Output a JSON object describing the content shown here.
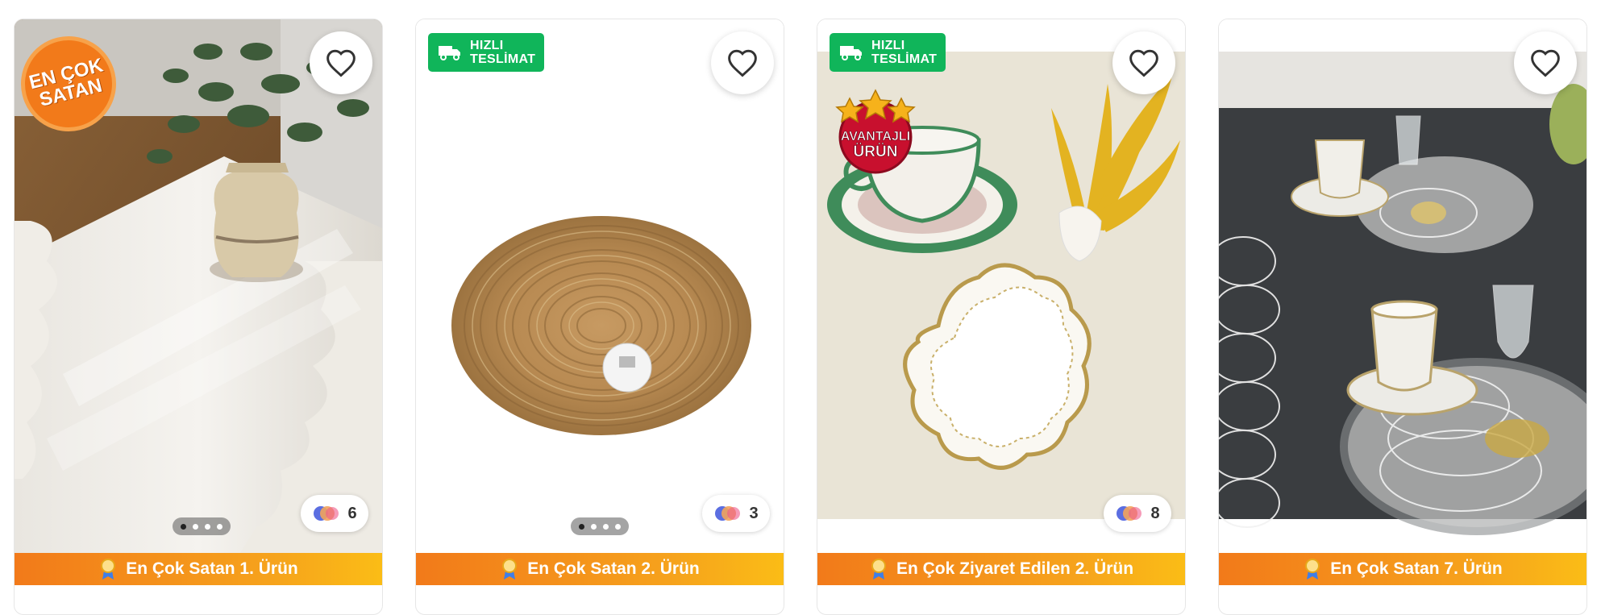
{
  "cards": [
    {
      "ribbon": "En Çok Satan 1. Ürün",
      "color_count": "6",
      "badge": {
        "line1": "EN ÇOK",
        "line2": "SATAN"
      }
    },
    {
      "ribbon": "En Çok Satan 2. Ürün",
      "color_count": "3",
      "fast_delivery": {
        "line1": "HIZLI",
        "line2": "TESLİMAT"
      }
    },
    {
      "ribbon": "En Çok Ziyaret Edilen 2. Ürün",
      "color_count": "8",
      "fast_delivery": {
        "line1": "HIZLI",
        "line2": "TESLİMAT"
      },
      "badge": {
        "line1": "AVANTAJLI",
        "line2": "ÜRÜN"
      }
    },
    {
      "ribbon": "En Çok Satan 7. Ürün"
    }
  ],
  "colors": {
    "ribbon_start": "#f27a1a",
    "ribbon_end": "#fbbd16",
    "fast_delivery_bg": "#10b55a",
    "badge_orange": "#f27a1a",
    "badge_red": "#c8102e"
  },
  "icons": {
    "favorite": "heart-outline-icon",
    "truck": "truck-icon",
    "medal": "medal-icon",
    "colors": "color-swatch-icon"
  }
}
